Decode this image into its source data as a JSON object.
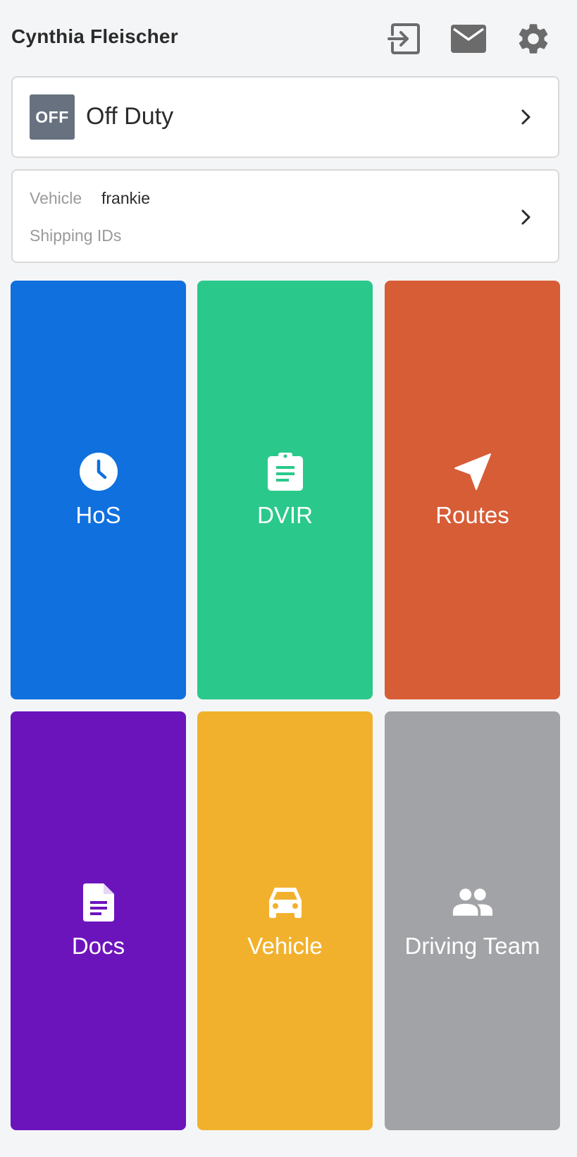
{
  "header": {
    "user_name": "Cynthia Fleischer",
    "icons": [
      "logout-icon",
      "mail-icon",
      "gear-icon"
    ]
  },
  "status": {
    "badge": "OFF",
    "label": "Off Duty",
    "badge_color": "#67717f"
  },
  "vehicle_info": {
    "vehicle_label": "Vehicle",
    "vehicle_value": "frankie",
    "shipping_label": "Shipping IDs"
  },
  "tiles": [
    {
      "label": "HoS",
      "icon": "clock-icon",
      "color": "#0f70de"
    },
    {
      "label": "DVIR",
      "icon": "clipboard-icon",
      "color": "#2ac98b"
    },
    {
      "label": "Routes",
      "icon": "navigation-arrow-icon",
      "color": "#d75d37"
    },
    {
      "label": "Docs",
      "icon": "document-icon",
      "color": "#6c14bc"
    },
    {
      "label": "Vehicle",
      "icon": "car-icon",
      "color": "#f2b12d"
    },
    {
      "label": "Driving Team",
      "icon": "people-icon",
      "color": "#a2a3a6"
    }
  ]
}
